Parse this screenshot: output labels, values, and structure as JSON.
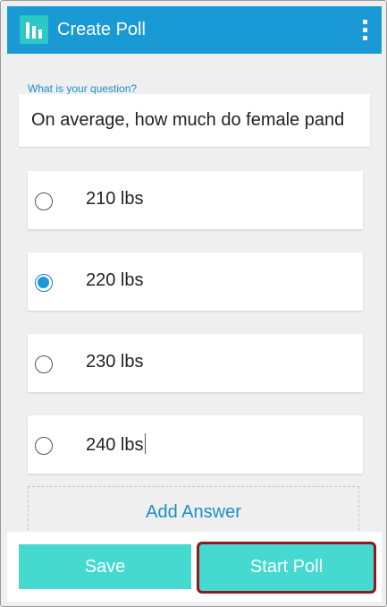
{
  "appbar": {
    "title": "Create Poll",
    "icon": "poll-chart-icon",
    "menu_icon": "overflow-menu-icon",
    "color": "#1a9ad4"
  },
  "question": {
    "label": "What is your question?",
    "value": "On average, how much do female pand"
  },
  "answers": [
    {
      "label": "210 lbs",
      "selected": false
    },
    {
      "label": "220 lbs",
      "selected": true
    },
    {
      "label": "230 lbs",
      "selected": false
    },
    {
      "label": "240 lbs",
      "selected": false
    }
  ],
  "add_answer_label": "Add Answer",
  "buttons": {
    "save_label": "Save",
    "start_label": "Start Poll",
    "color": "#45d9cf"
  }
}
